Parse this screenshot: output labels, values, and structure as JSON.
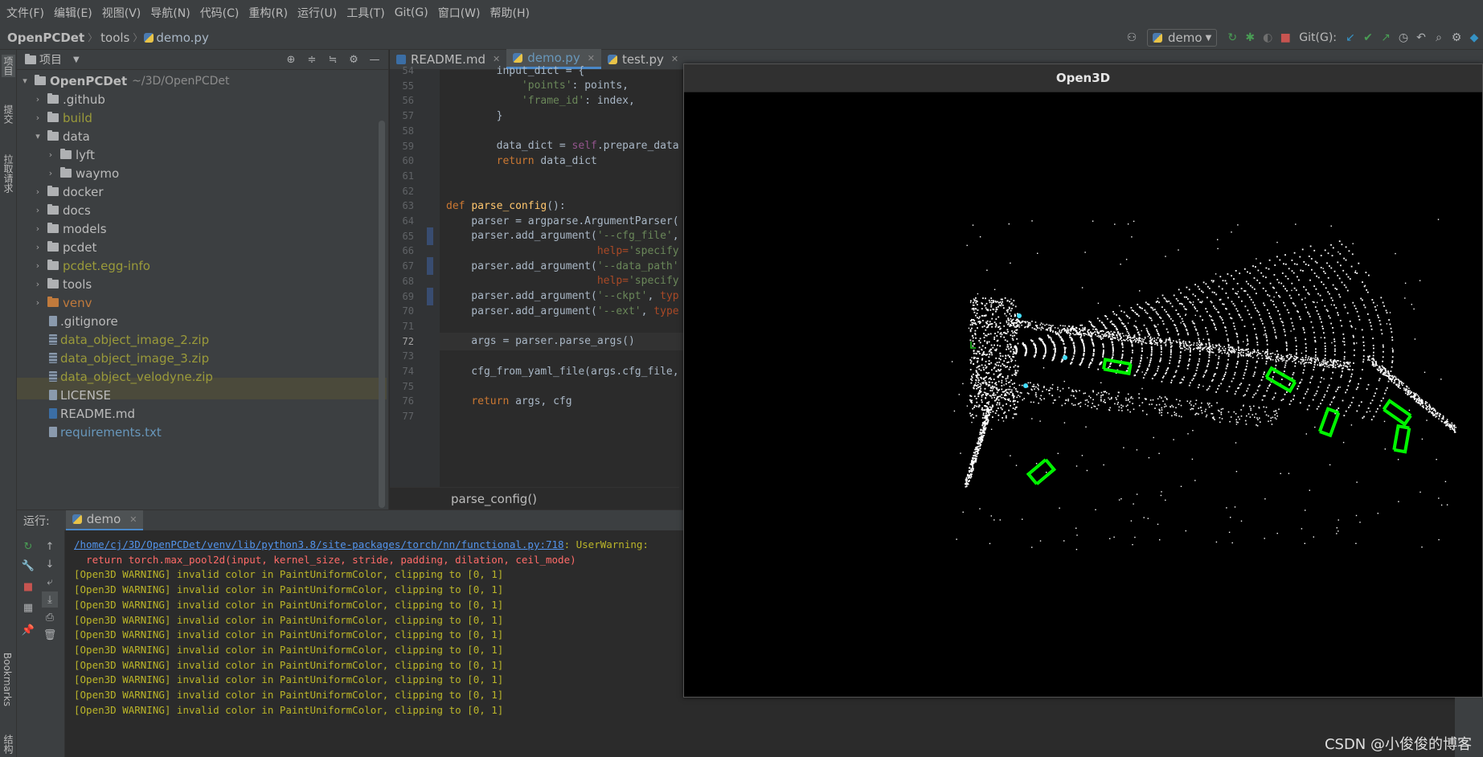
{
  "menu": [
    "文件(F)",
    "编辑(E)",
    "视图(V)",
    "导航(N)",
    "代码(C)",
    "重构(R)",
    "运行(U)",
    "工具(T)",
    "Git(G)",
    "窗口(W)",
    "帮助(H)"
  ],
  "navbar": {
    "project": "OpenPCDet",
    "folder": "tools",
    "file": "demo.py",
    "run_config": "demo",
    "git_label": "Git(G):"
  },
  "left_strip": {
    "project_tab": "项目",
    "commit_tab": "提交",
    "pull_tab": "拉取请求",
    "bookmarks_tab": "Bookmarks",
    "structure_tab": "结构"
  },
  "project_panel": {
    "title": "项目",
    "root_name": "OpenPCDet",
    "root_path": "~/3D/OpenPCDet",
    "items": [
      {
        "name": ".github",
        "kind": "folder",
        "expanded": false,
        "level": 1,
        "color": "default"
      },
      {
        "name": "build",
        "kind": "folder",
        "expanded": false,
        "level": 1,
        "color": "yellow"
      },
      {
        "name": "data",
        "kind": "folder",
        "expanded": true,
        "level": 1,
        "color": "default"
      },
      {
        "name": "lyft",
        "kind": "folder",
        "expanded": false,
        "level": 2,
        "color": "default"
      },
      {
        "name": "waymo",
        "kind": "folder",
        "expanded": false,
        "level": 2,
        "color": "default"
      },
      {
        "name": "docker",
        "kind": "folder",
        "expanded": false,
        "level": 1,
        "color": "default"
      },
      {
        "name": "docs",
        "kind": "folder",
        "expanded": false,
        "level": 1,
        "color": "default"
      },
      {
        "name": "models",
        "kind": "folder",
        "expanded": false,
        "level": 1,
        "color": "default"
      },
      {
        "name": "pcdet",
        "kind": "folder",
        "expanded": false,
        "level": 1,
        "color": "default"
      },
      {
        "name": "pcdet.egg-info",
        "kind": "folder",
        "expanded": false,
        "level": 1,
        "color": "yellow"
      },
      {
        "name": "tools",
        "kind": "folder",
        "expanded": false,
        "level": 1,
        "color": "default"
      },
      {
        "name": "venv",
        "kind": "folder",
        "expanded": false,
        "level": 1,
        "color": "orange"
      },
      {
        "name": ".gitignore",
        "kind": "file",
        "level": 1,
        "color": "default"
      },
      {
        "name": "data_object_image_2.zip",
        "kind": "zip",
        "level": 1,
        "color": "yellow"
      },
      {
        "name": "data_object_image_3.zip",
        "kind": "zip",
        "level": 1,
        "color": "yellow"
      },
      {
        "name": "data_object_velodyne.zip",
        "kind": "zip",
        "level": 1,
        "color": "yellow"
      },
      {
        "name": "LICENSE",
        "kind": "txt",
        "level": 1,
        "color": "default"
      },
      {
        "name": "README.md",
        "kind": "md",
        "level": 1,
        "color": "default"
      },
      {
        "name": "requirements.txt",
        "kind": "txt",
        "level": 1,
        "color": "link"
      }
    ]
  },
  "editor": {
    "tabs": [
      {
        "label": "README.md",
        "active": false
      },
      {
        "label": "demo.py",
        "active": true
      },
      {
        "label": "test.py",
        "active": false
      }
    ],
    "breadcrumb": "parse_config()",
    "lines": [
      {
        "n": "54",
        "code": "        input_dict = {"
      },
      {
        "n": "55",
        "code": "            'points': points,"
      },
      {
        "n": "56",
        "code": "            'frame_id': index,"
      },
      {
        "n": "57",
        "code": "        }"
      },
      {
        "n": "58",
        "code": ""
      },
      {
        "n": "59",
        "code": "        data_dict = self.prepare_data"
      },
      {
        "n": "60",
        "code": "        return data_dict"
      },
      {
        "n": "61",
        "code": ""
      },
      {
        "n": "62",
        "code": ""
      },
      {
        "n": "63",
        "code": "def parse_config():"
      },
      {
        "n": "64",
        "code": "    parser = argparse.ArgumentParser("
      },
      {
        "n": "65",
        "code": "    parser.add_argument('--cfg_file',"
      },
      {
        "n": "66",
        "code": "                        help='specify"
      },
      {
        "n": "67",
        "code": "    parser.add_argument('--data_path'"
      },
      {
        "n": "68",
        "code": "                        help='specify"
      },
      {
        "n": "69",
        "code": "    parser.add_argument('--ckpt', typ"
      },
      {
        "n": "70",
        "code": "    parser.add_argument('--ext', type"
      },
      {
        "n": "71",
        "code": ""
      },
      {
        "n": "72",
        "code": "    args = parser.parse_args()"
      },
      {
        "n": "73",
        "code": ""
      },
      {
        "n": "74",
        "code": "    cfg_from_yaml_file(args.cfg_file,"
      },
      {
        "n": "75",
        "code": ""
      },
      {
        "n": "76",
        "code": "    return args, cfg"
      },
      {
        "n": "77",
        "code": ""
      }
    ]
  },
  "run_panel": {
    "label": "运行:",
    "tab": "demo",
    "console": [
      {
        "type": "path",
        "text": "/home/cj/3D/OpenPCDet/venv/lib/python3.8/site-packages/torch/nn/functional.py:718",
        "suffix": ": UserWarning:"
      },
      {
        "type": "err",
        "text": "  return torch.max_pool2d(input, kernel_size, stride, padding, dilation, ceil_mode)"
      },
      {
        "type": "warn",
        "text": "[Open3D WARNING] invalid color in PaintUniformColor, clipping to [0, 1]"
      },
      {
        "type": "warn",
        "text": "[Open3D WARNING] invalid color in PaintUniformColor, clipping to [0, 1]"
      },
      {
        "type": "warn",
        "text": "[Open3D WARNING] invalid color in PaintUniformColor, clipping to [0, 1]"
      },
      {
        "type": "warn",
        "text": "[Open3D WARNING] invalid color in PaintUniformColor, clipping to [0, 1]"
      },
      {
        "type": "warn",
        "text": "[Open3D WARNING] invalid color in PaintUniformColor, clipping to [0, 1]"
      },
      {
        "type": "warn",
        "text": "[Open3D WARNING] invalid color in PaintUniformColor, clipping to [0, 1]"
      },
      {
        "type": "warn",
        "text": "[Open3D WARNING] invalid color in PaintUniformColor, clipping to [0, 1]"
      },
      {
        "type": "warn",
        "text": "[Open3D WARNING] invalid color in PaintUniformColor, clipping to [0, 1]"
      },
      {
        "type": "warn",
        "text": "[Open3D WARNING] invalid color in PaintUniformColor, clipping to [0, 1]"
      },
      {
        "type": "warn",
        "text": "[Open3D WARNING] invalid color in PaintUniformColor, clipping to [0, 1]"
      }
    ]
  },
  "open3d_window": {
    "title": "Open3D",
    "point_color": "#ffffff",
    "box_color": "#00ff00",
    "highlight_color": "#44e0ff",
    "background": "#000000"
  },
  "watermark": "CSDN @小俊俊的博客",
  "colors": {
    "accent": "#4a88c7",
    "warning": "#bbb529",
    "error": "#ff6b68"
  }
}
